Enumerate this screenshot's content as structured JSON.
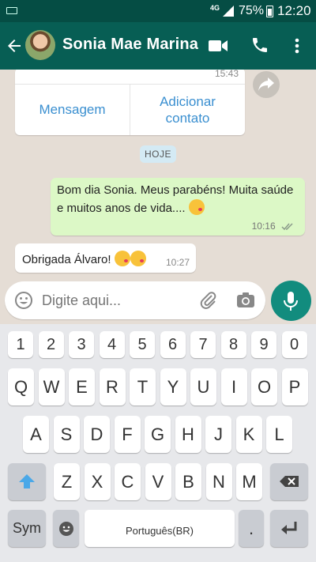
{
  "status_bar": {
    "network": "4G",
    "battery_percent": "75%",
    "time": "12:20"
  },
  "header": {
    "contact_name": "Sonia Mae Marina"
  },
  "contact_card": {
    "time": "15:43",
    "message_label": "Mensagem",
    "add_contact_label": "Adicionar contato"
  },
  "date_badge": "HOJE",
  "messages": [
    {
      "direction": "out",
      "text": "Bom dia Sonia. Meus parabéns! Muita saúde e muitos anos de vida....",
      "time": "10:16",
      "status": "read"
    },
    {
      "direction": "in",
      "text": "Obrigada Álvaro!",
      "time": "10:27"
    }
  ],
  "input": {
    "placeholder": "Digite aqui..."
  },
  "keyboard": {
    "number_row": [
      "1",
      "2",
      "3",
      "4",
      "5",
      "6",
      "7",
      "8",
      "9",
      "0"
    ],
    "row1": [
      "Q",
      "W",
      "E",
      "R",
      "T",
      "Y",
      "U",
      "I",
      "O",
      "P"
    ],
    "row2": [
      "A",
      "S",
      "D",
      "F",
      "G",
      "H",
      "J",
      "K",
      "L"
    ],
    "row3": [
      "Z",
      "X",
      "C",
      "V",
      "B",
      "N",
      "M"
    ],
    "sym_label": "Sym",
    "space_label": "Português(BR)",
    "period_label": "."
  },
  "colors": {
    "header": "#075e54",
    "status_bar": "#054d44",
    "outgoing_bubble": "#dcf8c6",
    "accent": "#128c7e",
    "link_blue": "#3a8fd0"
  }
}
